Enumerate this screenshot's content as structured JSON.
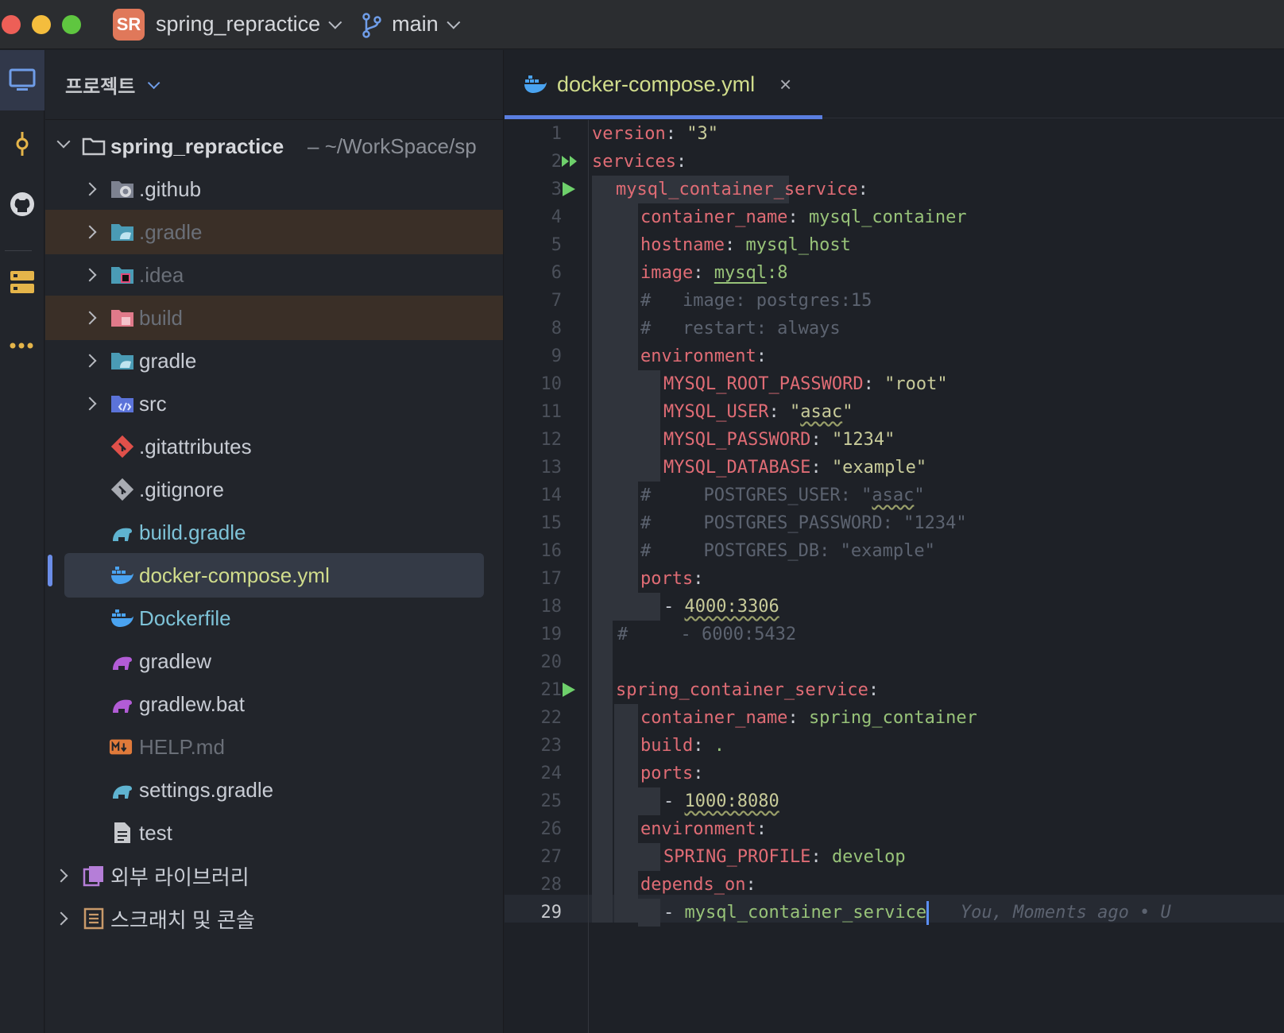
{
  "titlebar": {
    "project_initials": "SR",
    "project_name": "spring_repractice",
    "branch": "main"
  },
  "panel": {
    "title": "프로젝트",
    "root": {
      "name": "spring_repractice",
      "path": "~/WorkSpace/sp"
    },
    "items": [
      {
        "label": ".github",
        "type": "folder",
        "color": "#c7c9cd"
      },
      {
        "label": ".gradle",
        "type": "folder",
        "color": "#6a6f78"
      },
      {
        "label": ".idea",
        "type": "folder",
        "color": "#6a6f78"
      },
      {
        "label": "build",
        "type": "folder",
        "color": "#6a6f78"
      },
      {
        "label": "gradle",
        "type": "folder",
        "color": "#c7c9cd"
      },
      {
        "label": "src",
        "type": "folder",
        "color": "#c7c9cd"
      },
      {
        "label": ".gitattributes",
        "type": "file",
        "color": "#c7c9cd"
      },
      {
        "label": ".gitignore",
        "type": "file",
        "color": "#c7c9cd"
      },
      {
        "label": "build.gradle",
        "type": "file",
        "color": "#7ec3d8"
      },
      {
        "label": "docker-compose.yml",
        "type": "file",
        "color": "#d1dd8c"
      },
      {
        "label": "Dockerfile",
        "type": "file",
        "color": "#7ec3d8"
      },
      {
        "label": "gradlew",
        "type": "file",
        "color": "#c7c9cd"
      },
      {
        "label": "gradlew.bat",
        "type": "file",
        "color": "#c7c9cd"
      },
      {
        "label": "HELP.md",
        "type": "file",
        "color": "#6a6f78"
      },
      {
        "label": "settings.gradle",
        "type": "file",
        "color": "#c7c9cd"
      },
      {
        "label": "test",
        "type": "file",
        "color": "#c7c9cd"
      }
    ],
    "extras": [
      {
        "label": "외부 라이브러리"
      },
      {
        "label": "스크래치 및 콘솔"
      }
    ]
  },
  "editor": {
    "tab_label": "docker-compose.yml",
    "tab_close": "×",
    "current_line": 29,
    "blame_hint": "You, Moments ago • U"
  },
  "colors": {
    "accent": "#5a7ee0",
    "key": "#e06c75",
    "string": "#98c379",
    "comment": "#5c6370"
  }
}
